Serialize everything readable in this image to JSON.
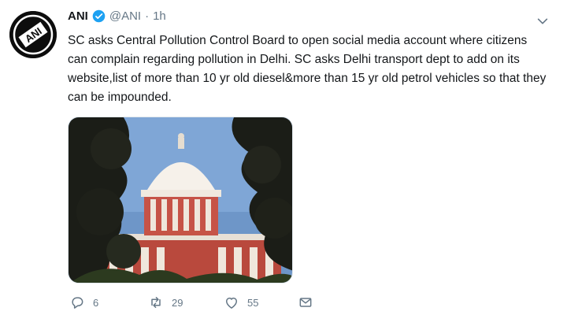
{
  "tweet": {
    "author_name": "ANI",
    "handle": "@ANI",
    "separator": "·",
    "time": "1h",
    "text": "SC asks Central Pollution Control Board to open social media account where citizens can complain regarding pollution in Delhi. SC asks Delhi transport dept to add on its website,list of more than 10 yr old diesel&more than 15 yr old petrol vehicles so that they can be impounded.",
    "avatar_logo_text": "ANI",
    "media_icon": "supreme-court-building-photo",
    "verified_color": "#1da1f2"
  },
  "actions": {
    "reply_count": "6",
    "retweet_count": "29",
    "like_count": "55"
  },
  "colors": {
    "text": "#14171a",
    "muted": "#657786"
  }
}
